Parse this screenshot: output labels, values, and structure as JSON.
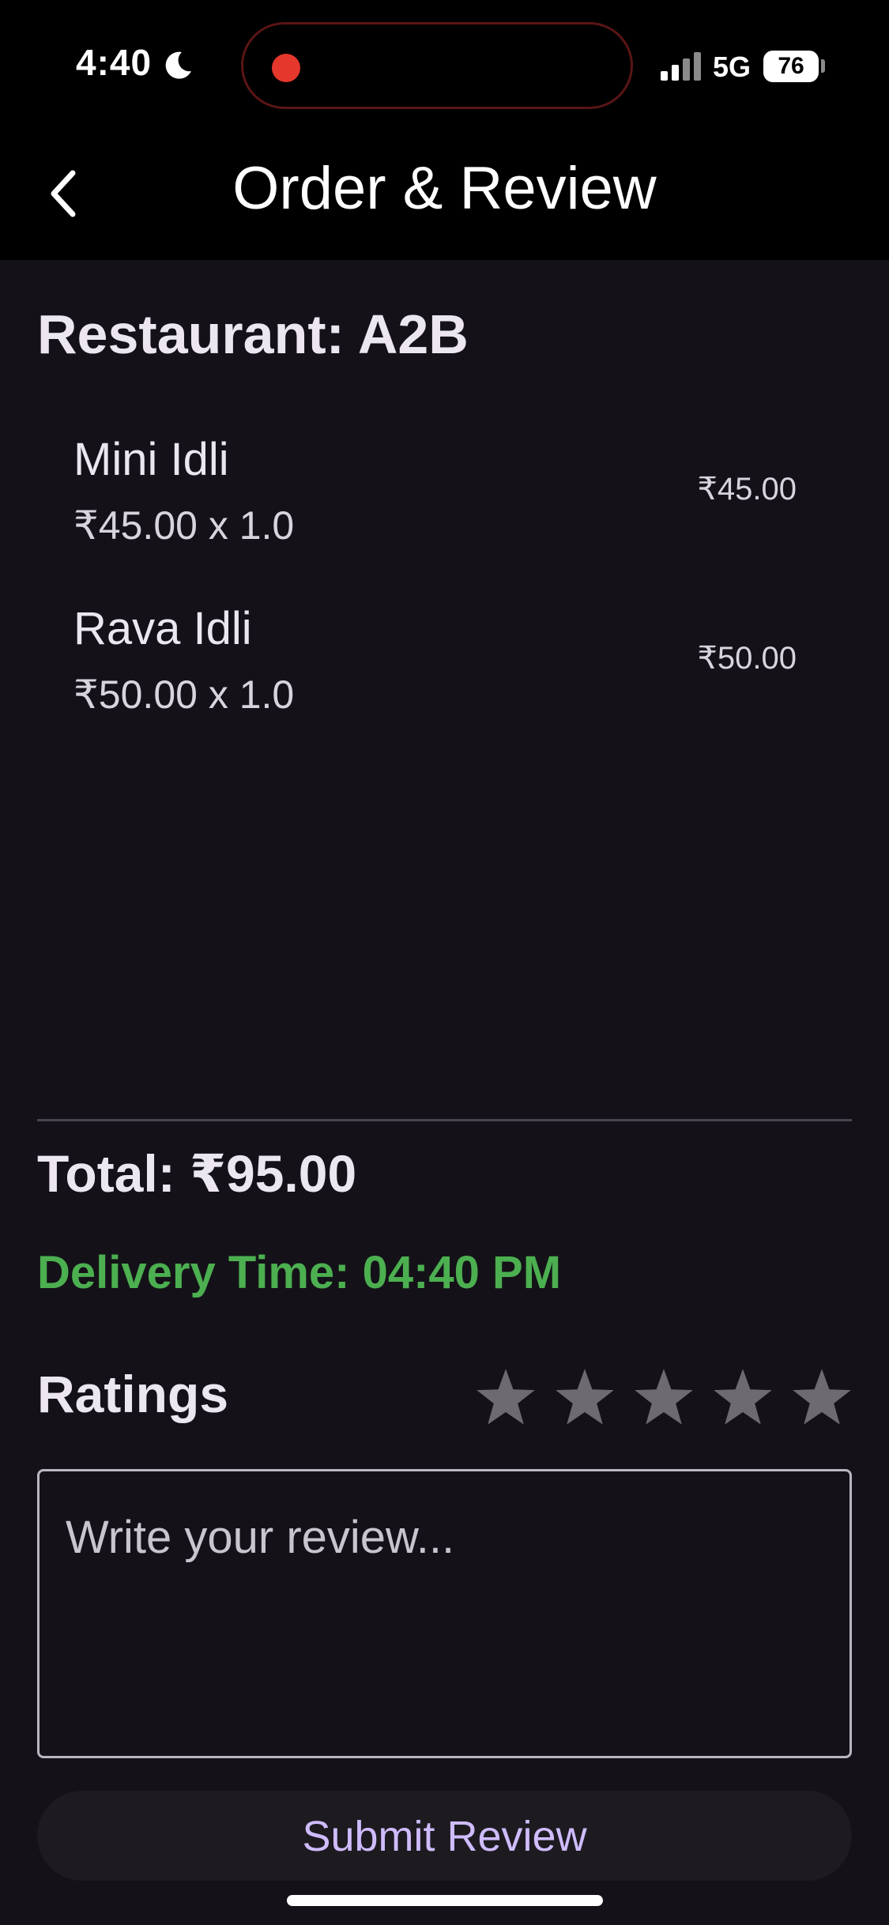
{
  "status_bar": {
    "time": "4:40",
    "network": "5G",
    "battery": "76",
    "icons": [
      "moon-icon",
      "recording-dot-icon",
      "signal-icon",
      "battery-icon"
    ]
  },
  "app_bar": {
    "title": "Order & Review",
    "back_icon": "chevron-left-icon"
  },
  "order": {
    "restaurant": "Restaurant: A2B",
    "items": [
      {
        "name": "Mini Idli",
        "qty_line": "₹45.00 x 1.0",
        "total": "₹45.00"
      },
      {
        "name": "Rava Idli",
        "qty_line": "₹50.00 x 1.0",
        "total": "₹50.00"
      }
    ],
    "total": "Total: ₹95.00",
    "delivery": "Delivery Time: 04:40 PM"
  },
  "ratings": {
    "label": "Ratings",
    "stars_total": 5,
    "stars_selected": 0,
    "star_color": "#6d6a70"
  },
  "review": {
    "placeholder": "Write your review..."
  },
  "submit_label": "Submit Review",
  "colors": {
    "background": "#141218",
    "delivery": "#4caf50",
    "accent": "#cfbcff"
  }
}
